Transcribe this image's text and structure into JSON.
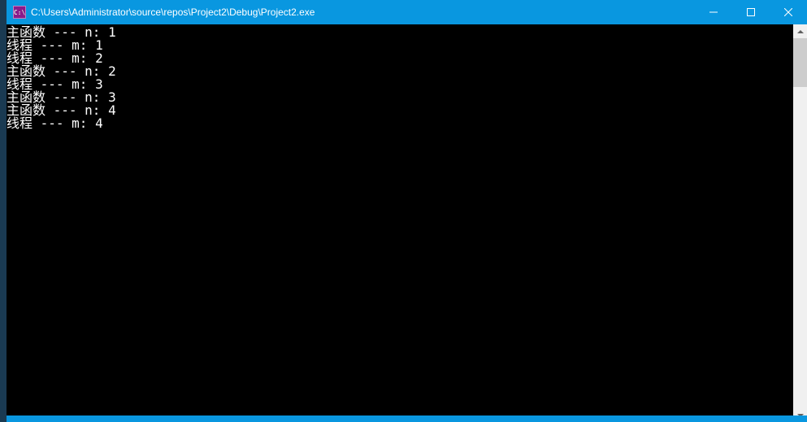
{
  "window": {
    "icon_text": "C:\\",
    "title": "C:\\Users\\Administrator\\source\\repos\\Project2\\Debug\\Project2.exe"
  },
  "console": {
    "lines": [
      "主函数 --- n: 1",
      "线程 --- m: 1",
      "线程 --- m: 2",
      "主函数 --- n: 2",
      "线程 --- m: 3",
      "主函数 --- n: 3",
      "主函数 --- n: 4",
      "线程 --- m: 4"
    ]
  }
}
